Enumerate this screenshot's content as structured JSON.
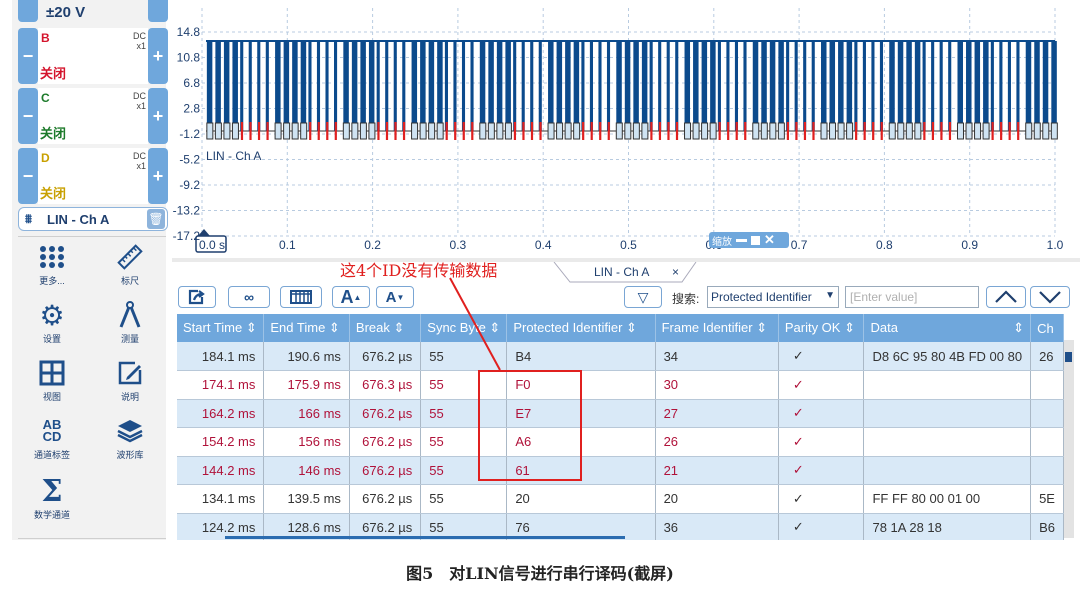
{
  "sidebar": {
    "range": "±20 V",
    "channels": [
      {
        "name": "B",
        "coupling": "DC",
        "probe": "x1",
        "state": "关闭",
        "color": "#d4142c"
      },
      {
        "name": "C",
        "coupling": "DC",
        "probe": "x1",
        "state": "关闭",
        "color": "#1c7a2a"
      },
      {
        "name": "D",
        "coupling": "DC",
        "probe": "x1",
        "state": "关闭",
        "color": "#c8a000"
      }
    ],
    "decoder": {
      "label": "LIN - Ch A"
    },
    "tools": [
      {
        "icon": "grid-dots-icon",
        "label": "更多..."
      },
      {
        "icon": "ruler-icon",
        "label": "标尺"
      },
      {
        "icon": "gear-icon",
        "label": "设置"
      },
      {
        "icon": "compass-icon",
        "label": "测量"
      },
      {
        "icon": "view-grid-icon",
        "label": "视图"
      },
      {
        "icon": "note-pencil-icon",
        "label": "说明"
      },
      {
        "icon": "abcd-icon",
        "label": "通道标签"
      },
      {
        "icon": "stack-icon",
        "label": "波形库"
      },
      {
        "icon": "sigma-icon",
        "label": "数学通道"
      }
    ]
  },
  "scope": {
    "y_ticks": [
      "14.8",
      "10.8",
      "6.8",
      "2.8",
      "-1.2",
      "-5.2",
      "-9.2",
      "-13.2",
      "-17.2"
    ],
    "x_ticks": [
      "0.0 s",
      "0.1",
      "0.2",
      "0.3",
      "0.4",
      "0.5",
      "0.6",
      "0.7",
      "0.8",
      "0.9",
      "1.0"
    ],
    "trace_label": "LIN - Ch A",
    "zoom_widget_label": "缩放",
    "signal_color": "#0b4a8c",
    "decode_color": "#e0201f"
  },
  "tabs": [
    {
      "label": "LIN - Ch A",
      "close": "×"
    }
  ],
  "annotation": "这4个ID没有传输数据",
  "toolbar": {
    "filter_icon": "▽",
    "search_label": "搜索:",
    "search_field": "Protected Identifier",
    "search_placeholder": "[Enter value]",
    "font_up": "A",
    "font_down": "A"
  },
  "table": {
    "columns": [
      "Start Time ⇕",
      "End Time ⇕",
      "Break ⇕",
      "Sync Byte ⇕",
      "Protected Identifier ⇕",
      "Frame Identifier ⇕",
      "Parity OK ⇕",
      "Data",
      "Ch"
    ],
    "rows": [
      {
        "start": "184.1 ms",
        "end": "190.6 ms",
        "brk": "676.2 µs",
        "sync": "55",
        "pid": "B4",
        "fid": "34",
        "parity": "✓",
        "data": "D8 6C 95 80 4B FD 00 80",
        "chk": "26",
        "error": false
      },
      {
        "start": "174.1 ms",
        "end": "175.9 ms",
        "brk": "676.3 µs",
        "sync": "55",
        "pid": "F0",
        "fid": "30",
        "parity": "✓",
        "data": "",
        "chk": "",
        "error": true
      },
      {
        "start": "164.2 ms",
        "end": "166 ms",
        "brk": "676.2 µs",
        "sync": "55",
        "pid": "E7",
        "fid": "27",
        "parity": "✓",
        "data": "",
        "chk": "",
        "error": true
      },
      {
        "start": "154.2 ms",
        "end": "156 ms",
        "brk": "676.2 µs",
        "sync": "55",
        "pid": "A6",
        "fid": "26",
        "parity": "✓",
        "data": "",
        "chk": "",
        "error": true
      },
      {
        "start": "144.2 ms",
        "end": "146 ms",
        "brk": "676.2 µs",
        "sync": "55",
        "pid": "61",
        "fid": "21",
        "parity": "✓",
        "data": "",
        "chk": "",
        "error": true
      },
      {
        "start": "134.1 ms",
        "end": "139.5 ms",
        "brk": "676.2 µs",
        "sync": "55",
        "pid": "20",
        "fid": "20",
        "parity": "✓",
        "data": "FF FF 80 00 01 00",
        "chk": "5E",
        "error": false
      },
      {
        "start": "124.2 ms",
        "end": "128.6 ms",
        "brk": "676.2 µs",
        "sync": "55",
        "pid": "76",
        "fid": "36",
        "parity": "✓",
        "data": "78 1A 28 18",
        "chk": "B6",
        "error": false
      }
    ]
  },
  "caption": "图5　对LIN信号进行串行译码(截屏)"
}
